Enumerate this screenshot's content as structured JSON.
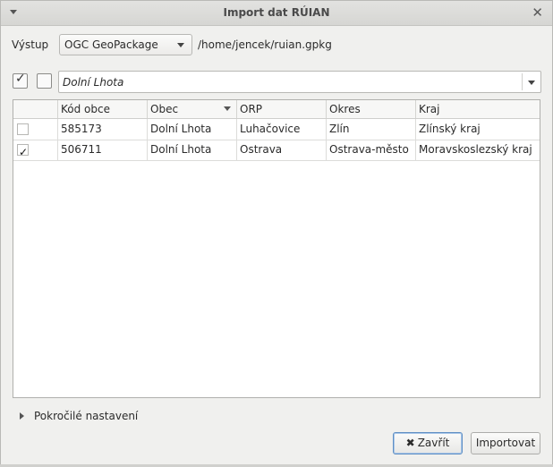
{
  "window": {
    "title": "Import dat RÚIAN",
    "close_glyph": "✕"
  },
  "output": {
    "label": "Výstup",
    "format": "OGC GeoPackage",
    "path": "/home/jencek/ruian.gpkg"
  },
  "filter": {
    "value": "Dolní Lhota"
  },
  "table": {
    "headers": [
      "Kód obce",
      "Obec",
      "ORP",
      "Okres",
      "Kraj"
    ],
    "rows": [
      {
        "checked": false,
        "cells": [
          "585173",
          "Dolní Lhota",
          "Luhačovice",
          "Zlín",
          "Zlínský kraj"
        ]
      },
      {
        "checked": true,
        "cells": [
          "506711",
          "Dolní Lhota",
          "Ostrava",
          "Ostrava-město",
          "Moravskoslezský kraj"
        ]
      }
    ]
  },
  "advanced": {
    "label": "Pokročilé nastavení"
  },
  "buttons": {
    "close_label": "Zavřít",
    "close_icon": "✖",
    "import_label": "Importovat"
  },
  "glyphs": {
    "check": "✓"
  }
}
